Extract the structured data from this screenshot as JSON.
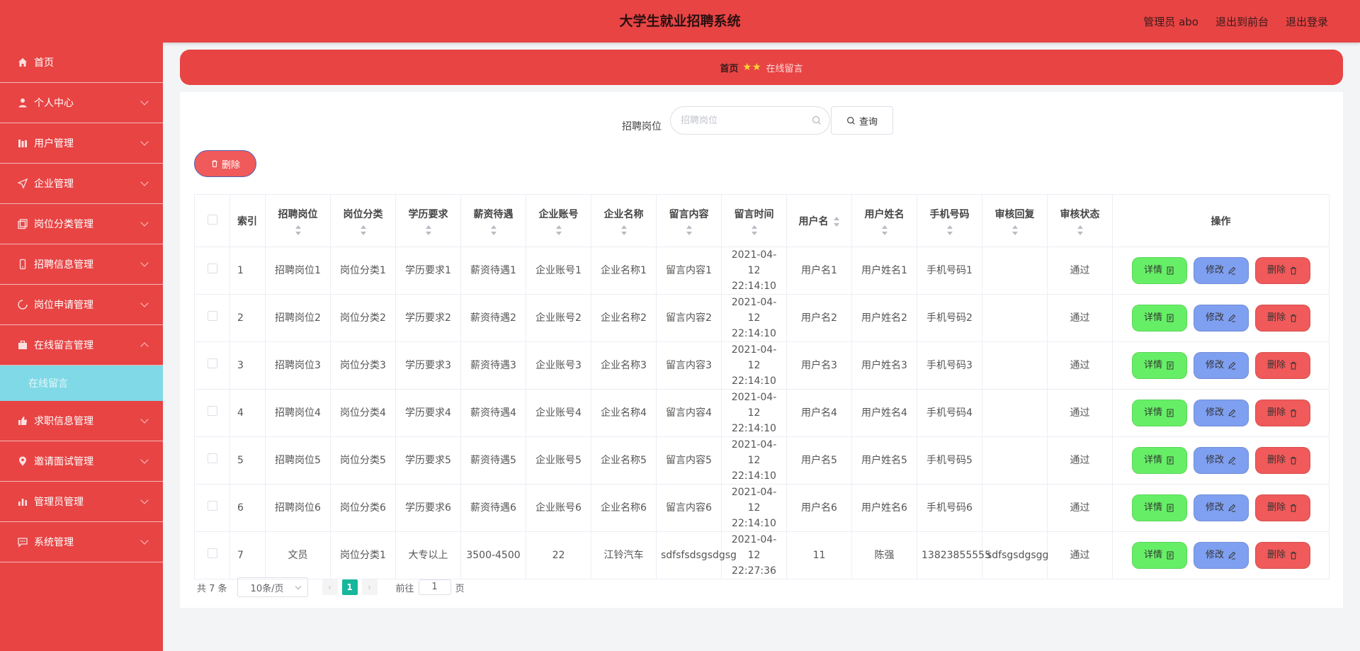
{
  "header": {
    "title": "大学生就业招聘系统",
    "user": "管理员 abo",
    "to_front": "退出到前台",
    "logout": "退出登录"
  },
  "sidebar": {
    "items": [
      {
        "label": "首页",
        "icon": "home-icon"
      },
      {
        "label": "个人中心",
        "icon": "user-icon"
      },
      {
        "label": "用户管理",
        "icon": "users-icon"
      },
      {
        "label": "企业管理",
        "icon": "send-icon"
      },
      {
        "label": "岗位分类管理",
        "icon": "copy-icon"
      },
      {
        "label": "招聘信息管理",
        "icon": "phone-icon"
      },
      {
        "label": "岗位申请管理",
        "icon": "loading-icon"
      },
      {
        "label": "在线留言管理",
        "icon": "briefcase-icon"
      },
      {
        "label": "求职信息管理",
        "icon": "thumb-icon"
      },
      {
        "label": "邀请面试管理",
        "icon": "location-icon"
      },
      {
        "label": "管理员管理",
        "icon": "chart-icon"
      },
      {
        "label": "系统管理",
        "icon": "message-icon"
      }
    ],
    "sub_active": "在线留言"
  },
  "breadcrumb": {
    "home": "首页",
    "current": "在线留言"
  },
  "search": {
    "label": "招聘岗位",
    "placeholder": "招聘岗位",
    "button": "查询"
  },
  "bulk_delete": "删除",
  "table": {
    "headers": {
      "index": "索引",
      "job": "招聘岗位",
      "category": "岗位分类",
      "education": "学历要求",
      "salary": "薪资待遇",
      "account": "企业账号",
      "company": "企业名称",
      "content": "留言内容",
      "time": "留言时间",
      "username": "用户名",
      "realname": "用户姓名",
      "phone": "手机号码",
      "reply": "审核回复",
      "status": "审核状态",
      "ops": "操作"
    },
    "rows": [
      {
        "index": "1",
        "job": "招聘岗位1",
        "category": "岗位分类1",
        "education": "学历要求1",
        "salary": "薪资待遇1",
        "account": "企业账号1",
        "company": "企业名称1",
        "content": "留言内容1",
        "time": "2021-04-12 22:14:10",
        "username": "用户名1",
        "realname": "用户姓名1",
        "phone": "手机号码1",
        "reply": "",
        "status": "通过"
      },
      {
        "index": "2",
        "job": "招聘岗位2",
        "category": "岗位分类2",
        "education": "学历要求2",
        "salary": "薪资待遇2",
        "account": "企业账号2",
        "company": "企业名称2",
        "content": "留言内容2",
        "time": "2021-04-12 22:14:10",
        "username": "用户名2",
        "realname": "用户姓名2",
        "phone": "手机号码2",
        "reply": "",
        "status": "通过"
      },
      {
        "index": "3",
        "job": "招聘岗位3",
        "category": "岗位分类3",
        "education": "学历要求3",
        "salary": "薪资待遇3",
        "account": "企业账号3",
        "company": "企业名称3",
        "content": "留言内容3",
        "time": "2021-04-12 22:14:10",
        "username": "用户名3",
        "realname": "用户姓名3",
        "phone": "手机号码3",
        "reply": "",
        "status": "通过"
      },
      {
        "index": "4",
        "job": "招聘岗位4",
        "category": "岗位分类4",
        "education": "学历要求4",
        "salary": "薪资待遇4",
        "account": "企业账号4",
        "company": "企业名称4",
        "content": "留言内容4",
        "time": "2021-04-12 22:14:10",
        "username": "用户名4",
        "realname": "用户姓名4",
        "phone": "手机号码4",
        "reply": "",
        "status": "通过"
      },
      {
        "index": "5",
        "job": "招聘岗位5",
        "category": "岗位分类5",
        "education": "学历要求5",
        "salary": "薪资待遇5",
        "account": "企业账号5",
        "company": "企业名称5",
        "content": "留言内容5",
        "time": "2021-04-12 22:14:10",
        "username": "用户名5",
        "realname": "用户姓名5",
        "phone": "手机号码5",
        "reply": "",
        "status": "通过"
      },
      {
        "index": "6",
        "job": "招聘岗位6",
        "category": "岗位分类6",
        "education": "学历要求6",
        "salary": "薪资待遇6",
        "account": "企业账号6",
        "company": "企业名称6",
        "content": "留言内容6",
        "time": "2021-04-12 22:14:10",
        "username": "用户名6",
        "realname": "用户姓名6",
        "phone": "手机号码6",
        "reply": "",
        "status": "通过"
      },
      {
        "index": "7",
        "job": "文员",
        "category": "岗位分类1",
        "education": "大专以上",
        "salary": "3500-4500",
        "account": "22",
        "company": "江铃汽车",
        "content": "sdfsfsdsgsdgsg",
        "time": "2021-04-12 22:27:36",
        "username": "11",
        "realname": "陈强",
        "phone": "13823855555",
        "reply": "sdfsgsdgsgg",
        "status": "通过"
      }
    ],
    "ops": {
      "detail": "详情",
      "edit": "修改",
      "delete": "删除"
    }
  },
  "pagination": {
    "total": "共 7 条",
    "page_size": "10条/页",
    "current_page": "1",
    "goto_label": "前往",
    "goto_value": "1",
    "page_unit": "页"
  },
  "colors": {
    "primary": "#e84444",
    "active_sub": "#80d9e6",
    "detail_btn": "#66ef66",
    "edit_btn": "#7f9ff0",
    "delete_btn": "#f05a5a",
    "page_active": "#16b79b"
  }
}
